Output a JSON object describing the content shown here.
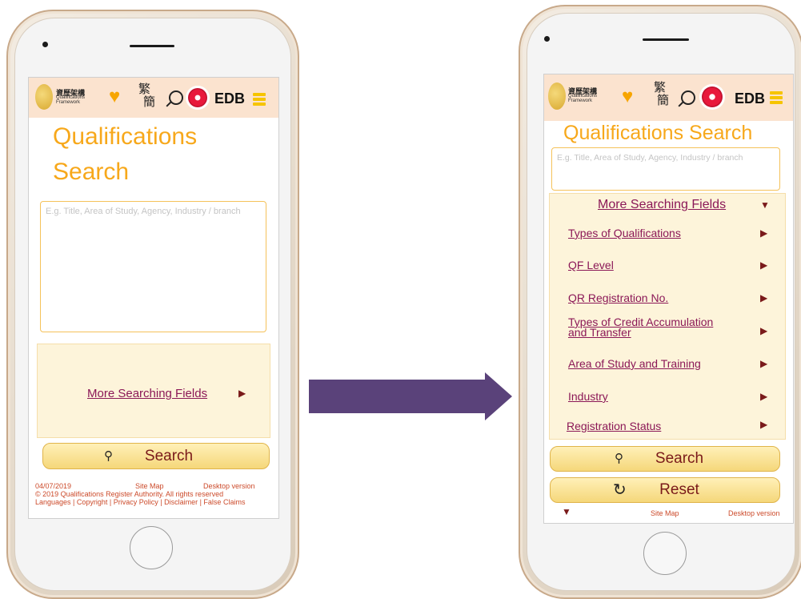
{
  "left_phone": {
    "header": {
      "logo_zh": "資歷架構",
      "logo_en_1": "Qualifications",
      "logo_en_2": "Framework",
      "lang_trad": "繁",
      "lang_simp": "簡",
      "edb": "EDB"
    },
    "title_line1": "Qualifications",
    "title_line2": "Search",
    "search_placeholder": "E.g. Title, Area of Study, Agency, Industry / branch",
    "more_fields": "More Searching Fields",
    "search_button": "Search",
    "footer": {
      "date": "04/07/2019",
      "site_map": "Site Map",
      "desktop": "Desktop version",
      "copyright": "© 2019 Qualifications Register Authority. All rights reserved",
      "links": "Languages | Copyright | Privacy Policy | Disclaimer | False Claims"
    }
  },
  "right_phone": {
    "header": {
      "logo_zh": "資歷架構",
      "logo_en_1": "Qualifications",
      "logo_en_2": "Framework",
      "lang_trad": "繁",
      "lang_simp": "簡",
      "edb": "EDB"
    },
    "title": "Qualifications Search",
    "search_placeholder": "E.g. Title, Area of Study, Agency, Industry / branch",
    "more_fields": "More Searching Fields",
    "fields": [
      {
        "label": "Types of Qualifications"
      },
      {
        "label": "QF Level"
      },
      {
        "label": "QR Registration No."
      },
      {
        "label_1": "Types of Credit Accumulation",
        "label_2": "and Transfer"
      },
      {
        "label": "Area of Study and Training"
      },
      {
        "label": "Industry"
      },
      {
        "label": "Registration Status"
      }
    ],
    "search_button": "Search",
    "reset_button": "Reset",
    "footer": {
      "site_map": "Site Map",
      "desktop": "Desktop version"
    }
  },
  "colors": {
    "accent": "#f7a81b",
    "link": "#8b1857",
    "header_bg": "#fbe3cf",
    "panel_bg": "#fdf4da",
    "arrow": "#5a427a"
  },
  "icons": [
    "search-icon",
    "heart-icon",
    "menu-icon",
    "hksar-flower-icon",
    "reset-icon",
    "triangle-right-icon",
    "triangle-down-icon"
  ]
}
